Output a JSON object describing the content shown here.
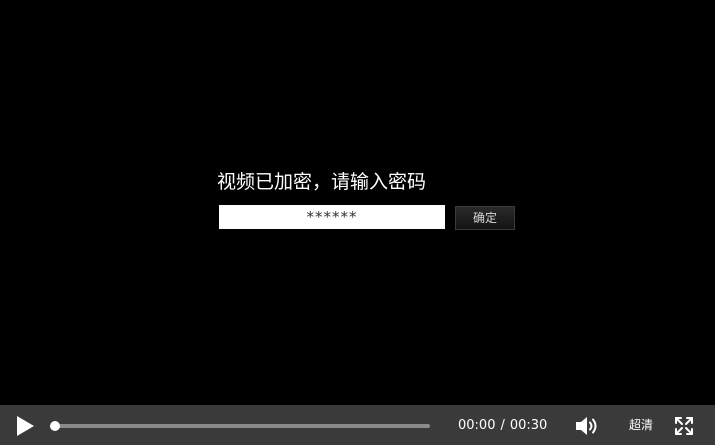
{
  "lock_prompt": {
    "title": "视频已加密，请输入密码",
    "password_value": "******",
    "confirm_label": "确定"
  },
  "player": {
    "current_time": "00:00",
    "time_separator": "/",
    "duration": "00:30",
    "progress_percent": 0,
    "quality_label": "超清"
  },
  "icons": {
    "play": "play-icon",
    "volume": "volume-icon",
    "fullscreen": "fullscreen-icon"
  },
  "colors": {
    "background": "#000000",
    "control_bar": "#3a3a3a",
    "progress_track": "#8a8a8a",
    "foreground": "#ffffff"
  }
}
